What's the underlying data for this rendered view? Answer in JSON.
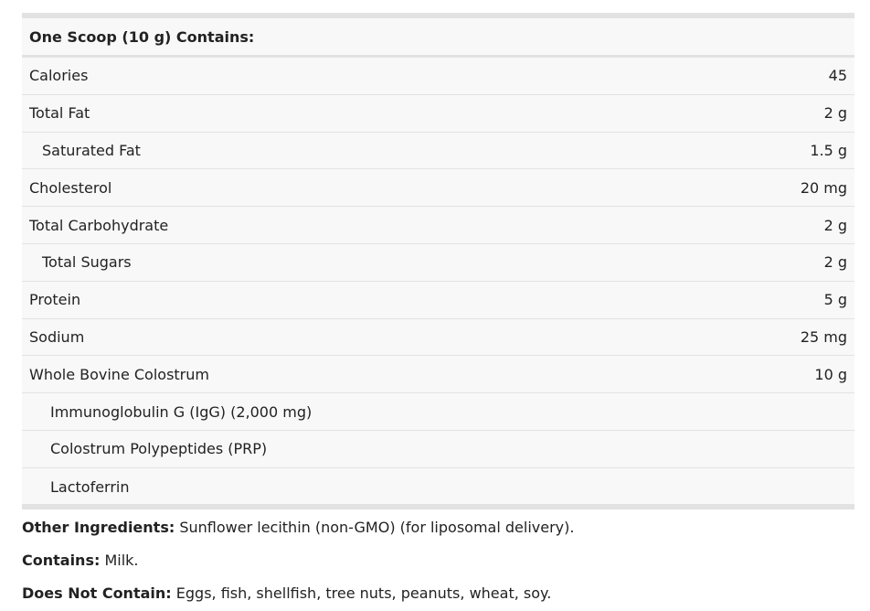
{
  "table": {
    "header": "One Scoop (10 g) Contains:",
    "rows": [
      {
        "name": "Calories",
        "amount": "45"
      },
      {
        "name": "Total Fat",
        "amount": "2 g"
      },
      {
        "name": "Saturated Fat",
        "amount": "1.5 g"
      },
      {
        "name": "Cholesterol",
        "amount": "20 mg"
      },
      {
        "name": "Total Carbohydrate",
        "amount": "2 g"
      },
      {
        "name": "Total Sugars",
        "amount": "2 g"
      },
      {
        "name": "Protein",
        "amount": "5 g"
      },
      {
        "name": "Sodium",
        "amount": "25 mg"
      },
      {
        "name": "Whole Bovine Colostrum",
        "amount": "10 g"
      },
      {
        "name": "Immunoglobulin G (IgG) (2,000 mg)",
        "amount": ""
      },
      {
        "name": "Colostrum Polypeptides (PRP)",
        "amount": ""
      },
      {
        "name": "Lactoferrin",
        "amount": ""
      }
    ]
  },
  "footer": {
    "other_ingredients_label": "Other Ingredients:",
    "other_ingredients_value": "Sunflower lecithin (non-GMO) (for liposomal delivery).",
    "contains_label": "Contains:",
    "contains_value": "Milk.",
    "does_not_contain_label": "Does Not Contain:",
    "does_not_contain_value": "Eggs, fish, shellfish, tree nuts, peanuts, wheat, soy."
  }
}
